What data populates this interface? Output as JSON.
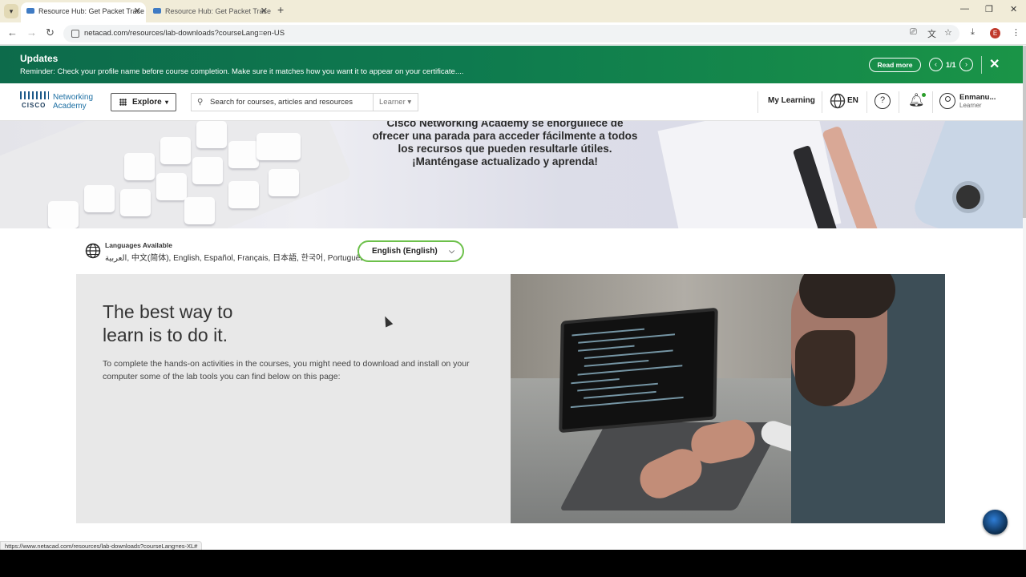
{
  "browser": {
    "tabs": [
      {
        "title": "Resource Hub: Get Packet Trace",
        "active": true
      },
      {
        "title": "Resource Hub: Get Packet Trace",
        "active": false
      }
    ],
    "url": "netacad.com/resources/lab-downloads?courseLang=en-US",
    "status_url": "https://www.netacad.com/resources/lab-downloads?courseLang=es-XL#"
  },
  "updates": {
    "title": "Updates",
    "message": "Reminder: Check your profile name before course completion. Make sure it matches how you want it to appear on your certificate....",
    "read_more": "Read more",
    "page": "1/1"
  },
  "header": {
    "logo_text": "CISCO",
    "brand_line1": "Networking",
    "brand_line2": "Academy",
    "explore": "Explore",
    "search_placeholder": "Search for courses, articles and resources",
    "role_select": "Learner",
    "my_learning": "My Learning",
    "language": "EN",
    "user_name": "Enmanu...",
    "user_role": "Learner"
  },
  "hero": {
    "line1": "Cisco Networking Academy se enorgullece de",
    "line2": "ofrecer una parada para acceder fácilmente a todos",
    "line3": "los recursos que pueden resultarle útiles.",
    "line4": "¡Manténgase actualizado y aprenda!"
  },
  "languages": {
    "title": "Languages Available",
    "list": "العربية, 中文(简体), English, Español, Français, 日本語, 한국어, Português",
    "selected": "English (English)"
  },
  "feature": {
    "heading_line1": "The best way to",
    "heading_line2": "learn is to do it.",
    "body": "To complete the hands-on activities in the courses, you might need to download and install on your computer some of the lab tools you can find below on this page:"
  },
  "colors": {
    "banner_green": "#0e7a4f",
    "select_border": "#6cc04a",
    "brand_blue": "#1d6fa3"
  }
}
